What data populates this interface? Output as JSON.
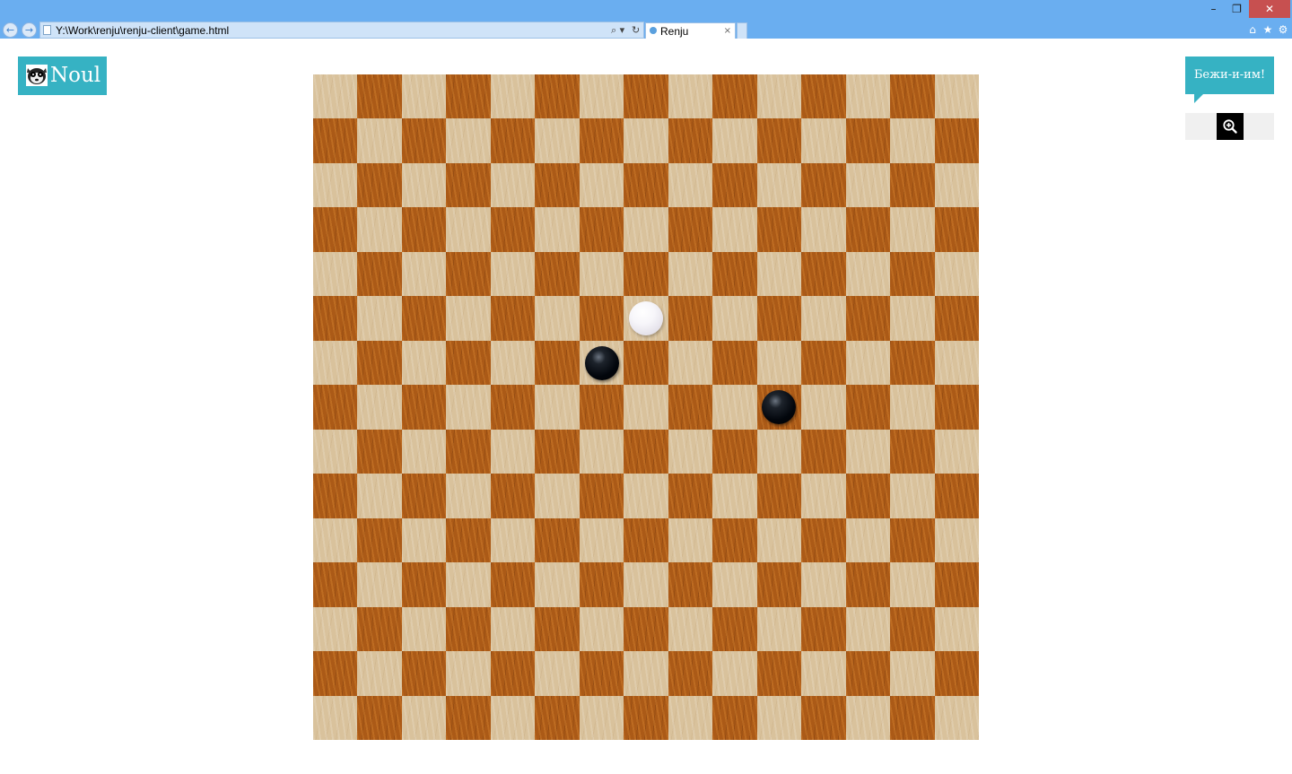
{
  "browser": {
    "address": "Y:\\Work\\renju\\renju-client\\game.html",
    "tab_title": "Renju",
    "tab_close": "×",
    "search_glyph": "⌕ ▾",
    "refresh_glyph": "↻",
    "window": {
      "minimize": "–",
      "restore": "❐",
      "close": "✕"
    },
    "tools": [
      "home-icon",
      "star-icon",
      "gear-icon"
    ]
  },
  "logo": {
    "text": "Noul"
  },
  "speech": {
    "text": "Бежи-и-им!"
  },
  "zoom": {
    "icon": "zoom-in-icon"
  },
  "board": {
    "size": 15,
    "corner_color": "light",
    "colors": {
      "light": "#d9c29c",
      "dark": "#ab5a17"
    },
    "stones": [
      {
        "color": "white",
        "col": 7,
        "row": 5
      },
      {
        "color": "black",
        "col": 6,
        "row": 6
      },
      {
        "color": "black",
        "col": 10,
        "row": 7
      }
    ]
  },
  "colors": {
    "accent": "#36b2c3",
    "chrome": "#6aaef0",
    "close": "#c75050"
  }
}
